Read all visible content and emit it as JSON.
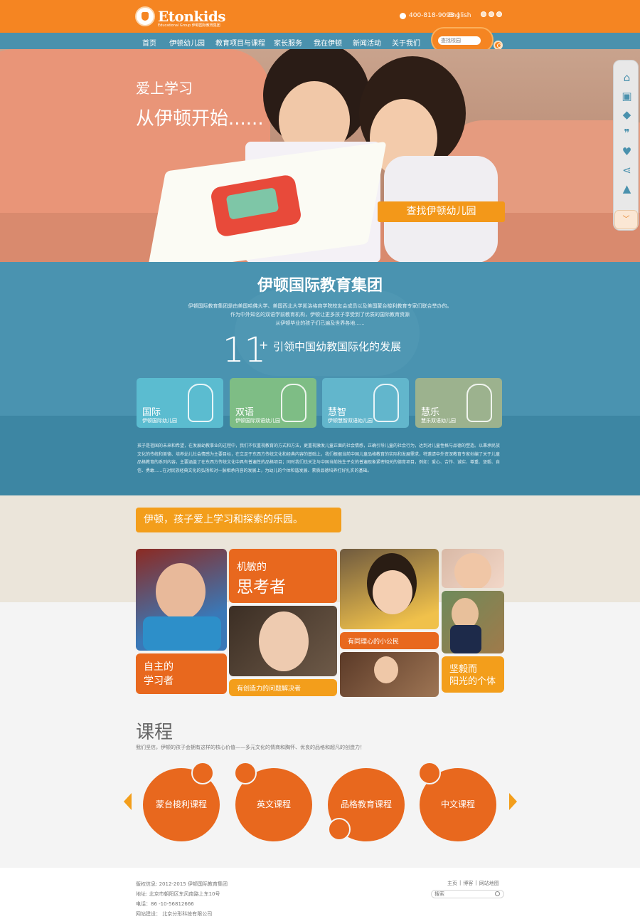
{
  "header": {
    "brand": "Etonkids",
    "brand_sub": "Educational Group 伊顿国际教育集团",
    "phone": "400-818-9098",
    "lang": "English"
  },
  "nav": {
    "items": [
      "首页",
      "伊顿幼儿园",
      "教育项目与课程",
      "家长服务",
      "我在伊顿",
      "新闻活动",
      "关于我们"
    ],
    "search_placeholder": "查找校园"
  },
  "hero": {
    "line1": "爱上学习",
    "line2": "从伊顿开始......",
    "cta": "查找伊顿幼儿园"
  },
  "intro": {
    "title": "伊顿国际教育集团",
    "lines": [
      "伊顿国际教育集团是由美国哈佛大学、美国西北大学凯洛格商学院校友会成员以及美国蒙台梭利教育专家们联合举办的。",
      "作为中外知名的双语学前教育机构，伊顿让更多孩子享受到了优质的国际教育资源",
      "从伊顿毕业的孩子们已遍及世界各地......"
    ],
    "number": "11",
    "plus": "+",
    "tagline": "引领中国幼教国际化的发展",
    "cards": [
      {
        "title": "国际",
        "sub": "伊顿国际幼儿园",
        "color": "#5bbcd0"
      },
      {
        "title": "双语",
        "sub": "伊顿国际双语幼儿园",
        "color": "#7ebd85"
      },
      {
        "title": "慧智",
        "sub": "伊顿慧智双语幼儿园",
        "color": "#62b6cc"
      },
      {
        "title": "慧乐",
        "sub": "慧乐双语幼儿园",
        "color": "#9cb28e"
      }
    ],
    "paragraph": "孩子是祖国的未来和希望，在发展幼教事业的过程中，我们不仅重视教育的方式和方法，更重视激发儿童正面的社会情感，正确引导儿童的社会行为，达到对儿童性格与品德的塑造。以秉承民族文化的传统和美德、培养幼儿社会情感为主要目标，在立足于东西方传统文化和经典内容的基础上，我们根据当前中国儿童品格教育的实际和发展需求，特邀请中外资深教育专家创编了关于儿童品格教育的系列内容，主要涵盖了在东西方传统文化中具有普遍性的品格项目；同时我们也关注与中国当前独生子女的普遍现象紧密相关的德育项目，例如：爱心、合作、诚实、尊重、坚毅、自信、勇敢......在对民族经典文化的弘扬和对一脉相承内容的发展上，为幼儿的个体和谐发展、素质品德培养打好扎实的基础。"
  },
  "band": {
    "title": "伊顿，孩子爱上学习和探索的乐园。"
  },
  "mosaic": {
    "thinker_small": "机敏的",
    "thinker_big": "思考者",
    "learner_1": "自主的",
    "learner_2": "学习者",
    "solver": "有创造力的问题解决者",
    "citizen": "有同理心的小公民",
    "resilient_1": "坚毅而",
    "resilient_2": "阳光的个体"
  },
  "courses": {
    "title": "课程",
    "subtitle": "我们坚信，伊顿的孩子会拥有这样的核心价值——多元文化的情商和胸怀、优良的品格和超凡的创造力！",
    "items": [
      "蒙台梭利课程",
      "英文课程",
      "品格教育课程",
      "中文课程"
    ]
  },
  "footer": {
    "copyright": "版权信息: 2012-2015 伊顿国际教育集团",
    "address": "地址: 北京市朝阳区东风南路上东10号",
    "tel": "电话：86 -10-56812666",
    "builder": "网站建设： 北京分形科技有限公司",
    "links": [
      "主页",
      "博客",
      "网站地图"
    ],
    "search_placeholder": "搜索"
  },
  "colors": {
    "orange": "#f58522",
    "blue": "#4a93b0",
    "amber": "#f39e1b"
  }
}
